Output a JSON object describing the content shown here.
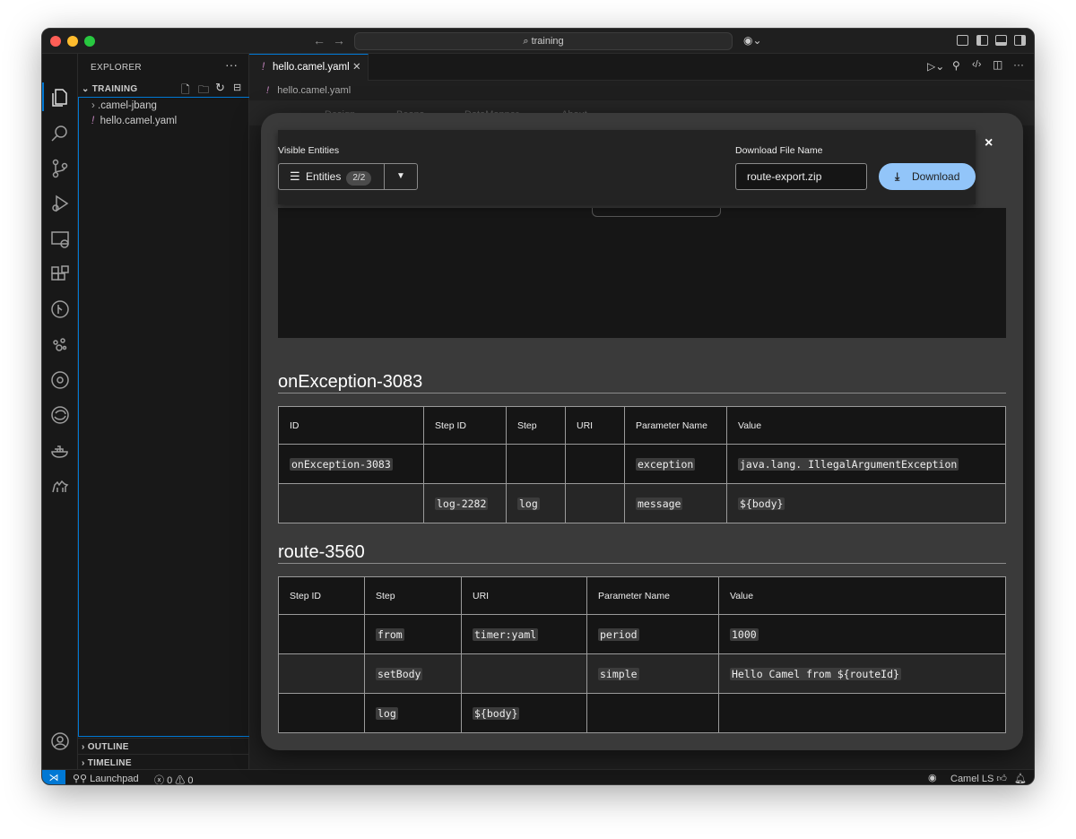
{
  "titlebar": {
    "search_text": "training"
  },
  "sidebar": {
    "title": "EXPLORER",
    "section": "TRAINING",
    "items": [
      {
        "label": ".camel-jbang",
        "type": "folder"
      },
      {
        "label": "hello.camel.yaml",
        "type": "file",
        "marker": "!"
      }
    ],
    "outline": "OUTLINE",
    "timeline": "TIMELINE"
  },
  "editor": {
    "tab_label": "hello.camel.yaml",
    "tab_marker": "!",
    "breadcrumb": "hello.camel.yaml",
    "designer_tabs": [
      "Design",
      "Beans",
      "DataMapper",
      "About"
    ]
  },
  "statusbar": {
    "launchpad": "Launchpad",
    "errors": "0",
    "warnings": "0",
    "camel_ls": "Camel LS"
  },
  "modal": {
    "visible_entities_label": "Visible Entities",
    "entities_button": "Entities",
    "entities_count": "2/2",
    "download_file_label": "Download File Name",
    "file_name_value": "route-export.zip",
    "download_button": "Download",
    "close": "×",
    "sections": [
      {
        "title": "onException-3083",
        "headers": [
          "ID",
          "Step ID",
          "Step",
          "URI",
          "Parameter Name",
          "Value"
        ],
        "rows": [
          [
            "onException-3083",
            "",
            "",
            "",
            "exception",
            "java.lang. IllegalArgumentException"
          ],
          [
            "",
            "log-2282",
            "log",
            "",
            "message",
            "${body}"
          ]
        ]
      },
      {
        "title": "route-3560",
        "headers": [
          "Step ID",
          "Step",
          "URI",
          "Parameter Name",
          "Value"
        ],
        "rows": [
          [
            "",
            "from",
            "timer:yaml",
            "period",
            "1000"
          ],
          [
            "",
            "setBody",
            "",
            "simple",
            "Hello Camel from ${routeId}"
          ],
          [
            "",
            "log",
            "${body}",
            "",
            ""
          ]
        ]
      }
    ]
  },
  "colors": {
    "accent": "#0078d4",
    "download_button": "#92c5f9",
    "modal_bg": "#3a3a3a"
  }
}
